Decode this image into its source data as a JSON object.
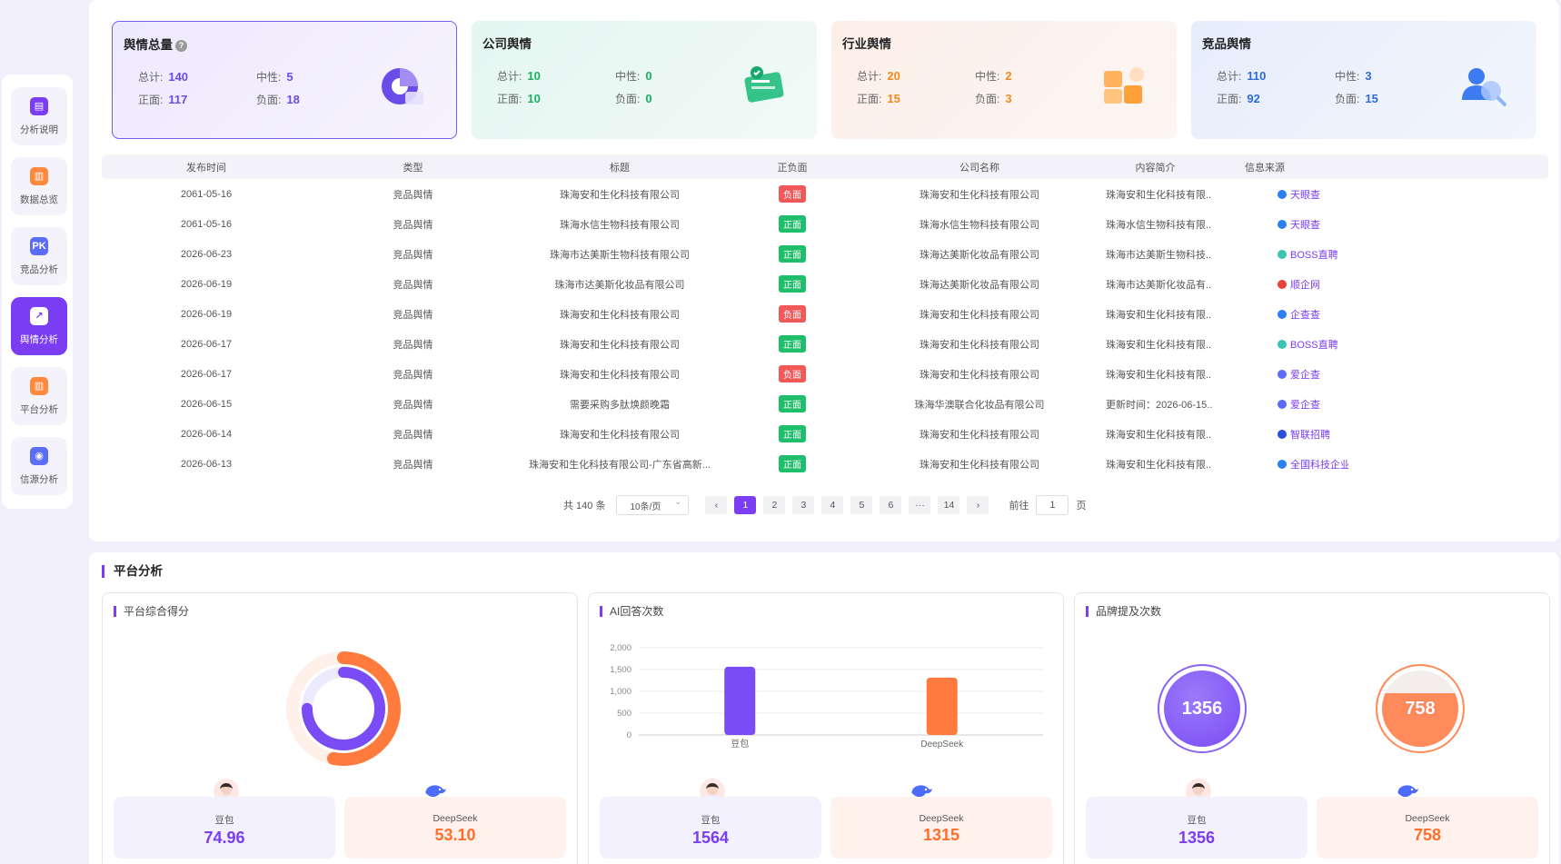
{
  "sidebar": {
    "items": [
      {
        "label": "分析说明",
        "icon": "doc-icon",
        "color": "#7a3df1"
      },
      {
        "label": "数据总览",
        "icon": "bar-chart-icon",
        "color": "#ff8a3d"
      },
      {
        "label": "竞品分析",
        "icon": "trophy-icon",
        "color": "#5b6cf7"
      },
      {
        "label": "舆情分析",
        "icon": "trend-icon",
        "color": "#7a3df1",
        "active": true
      },
      {
        "label": "平台分析",
        "icon": "column-chart-icon",
        "color": "#ff8a3d"
      },
      {
        "label": "信源分析",
        "icon": "signal-icon",
        "color": "#5b6cf7"
      }
    ]
  },
  "cards": [
    {
      "title": "舆情总量",
      "total_label": "总计:",
      "total": "140",
      "neutral_label": "中性:",
      "neutral": "5",
      "positive_label": "正面:",
      "positive": "117",
      "negative_label": "负面:",
      "negative": "18",
      "color": "#6a4ce8",
      "has_help": true
    },
    {
      "title": "公司舆情",
      "total_label": "总计:",
      "total": "10",
      "neutral_label": "中性:",
      "neutral": "0",
      "positive_label": "正面:",
      "positive": "10",
      "negative_label": "负面:",
      "negative": "0",
      "color": "#18b25f"
    },
    {
      "title": "行业舆情",
      "total_label": "总计:",
      "total": "20",
      "neutral_label": "中性:",
      "neutral": "2",
      "positive_label": "正面:",
      "positive": "15",
      "negative_label": "负面:",
      "negative": "3",
      "color": "#f08a1c"
    },
    {
      "title": "竞品舆情",
      "total_label": "总计:",
      "total": "110",
      "neutral_label": "中性:",
      "neutral": "3",
      "positive_label": "正面:",
      "positive": "92",
      "negative_label": "负面:",
      "negative": "15",
      "color": "#2f6bd8"
    }
  ],
  "table": {
    "headers": [
      "发布时间",
      "类型",
      "标题",
      "正负面",
      "公司名称",
      "内容简介",
      "信息来源"
    ],
    "rows": [
      {
        "date": "2061-05-16",
        "type": "竞品舆情",
        "title": "珠海安和生化科技有限公司",
        "sentiment": "负面",
        "neg": true,
        "company": "珠海安和生化科技有限公司",
        "summary": "珠海安和生化科技有限...",
        "source": "天眼查",
        "src_color": "#2b7ff0"
      },
      {
        "date": "2061-05-16",
        "type": "竞品舆情",
        "title": "珠海水信生物科技有限公司",
        "sentiment": "正面",
        "neg": false,
        "company": "珠海水信生物科技有限公司",
        "summary": "珠海水信生物科技有限...",
        "source": "天眼查",
        "src_color": "#2b7ff0"
      },
      {
        "date": "2026-06-23",
        "type": "竞品舆情",
        "title": "珠海市达美斯生物科技有限公司",
        "sentiment": "正面",
        "neg": false,
        "company": "珠海达美斯化妆品有限公司",
        "summary": "珠海市达美斯生物科技...",
        "source": "BOSS直聘",
        "src_color": "#3bc4b4"
      },
      {
        "date": "2026-06-19",
        "type": "竞品舆情",
        "title": "珠海市达美斯化妆品有限公司",
        "sentiment": "正面",
        "neg": false,
        "company": "珠海达美斯化妆品有限公司",
        "summary": "珠海市达美斯化妆品有...",
        "source": "顺企网",
        "src_color": "#e8433a"
      },
      {
        "date": "2026-06-19",
        "type": "竞品舆情",
        "title": "珠海安和生化科技有限公司",
        "sentiment": "负面",
        "neg": true,
        "company": "珠海安和生化科技有限公司",
        "summary": "珠海安和生化科技有限...",
        "source": "企查查",
        "src_color": "#2b7ff0"
      },
      {
        "date": "2026-06-17",
        "type": "竞品舆情",
        "title": "珠海安和生化科技有限公司",
        "sentiment": "正面",
        "neg": false,
        "company": "珠海安和生化科技有限公司",
        "summary": "珠海安和生化科技有限...",
        "source": "BOSS直聘",
        "src_color": "#3bc4b4"
      },
      {
        "date": "2026-06-17",
        "type": "竞品舆情",
        "title": "珠海安和生化科技有限公司",
        "sentiment": "负面",
        "neg": true,
        "company": "珠海安和生化科技有限公司",
        "summary": "珠海安和生化科技有限...",
        "source": "爱企查",
        "src_color": "#5b6cf7"
      },
      {
        "date": "2026-06-15",
        "type": "竞品舆情",
        "title": "需要采购多肽焕颜晚霜",
        "sentiment": "正面",
        "neg": false,
        "company": "珠海华澳联合化妆品有限公司",
        "summary": "更新时间：2026-06-15...",
        "source": "爱企查",
        "src_color": "#5b6cf7"
      },
      {
        "date": "2026-06-14",
        "type": "竞品舆情",
        "title": "珠海安和生化科技有限公司",
        "sentiment": "正面",
        "neg": false,
        "company": "珠海安和生化科技有限公司",
        "summary": "珠海安和生化科技有限...",
        "source": "智联招聘",
        "src_color": "#2a4fd8"
      },
      {
        "date": "2026-06-13",
        "type": "竞品舆情",
        "title": "珠海安和生化科技有限公司-广东省高新...",
        "sentiment": "正面",
        "neg": false,
        "company": "珠海安和生化科技有限公司",
        "summary": "珠海安和生化科技有限...",
        "source": "全国科技企业...",
        "src_color": "#2b7ff0"
      }
    ]
  },
  "pagination": {
    "total_text": "共 140 条",
    "page_size": "10条/页",
    "prev": "‹",
    "pages": [
      "1",
      "2",
      "3",
      "4",
      "5",
      "6",
      "···",
      "14"
    ],
    "next": "›",
    "goto_label": "前往",
    "goto_value": "1",
    "goto_suffix": "页"
  },
  "platform": {
    "section_title": "平台分析",
    "score": {
      "title": "平台综合得分",
      "doubao_name": "豆包",
      "doubao_value": "74.96",
      "deepseek_name": "DeepSeek",
      "deepseek_value": "53.10",
      "doubao_score": 74.96,
      "deepseek_score": 53.1
    },
    "answers": {
      "title": "AI回答次数",
      "doubao_name": "豆包",
      "doubao_value": "1564",
      "deepseek_name": "DeepSeek",
      "deepseek_value": "1315"
    },
    "mentions": {
      "title": "品牌提及次数",
      "doubao_name": "豆包",
      "doubao_value": "1356",
      "deepseek_name": "DeepSeek",
      "deepseek_value": "758",
      "doubao_bubble": "1356",
      "deepseek_bubble": "758"
    }
  },
  "chart_data": {
    "type": "bar",
    "title": "AI回答次数",
    "categories": [
      "豆包",
      "DeepSeek"
    ],
    "values": [
      1564,
      1315
    ],
    "colors": [
      "#7a4cf5",
      "#ff7a3d"
    ],
    "ylim": [
      0,
      2000
    ],
    "yticks": [
      "0",
      "500",
      "1,000",
      "1,500",
      "2,000"
    ],
    "grid": true
  }
}
